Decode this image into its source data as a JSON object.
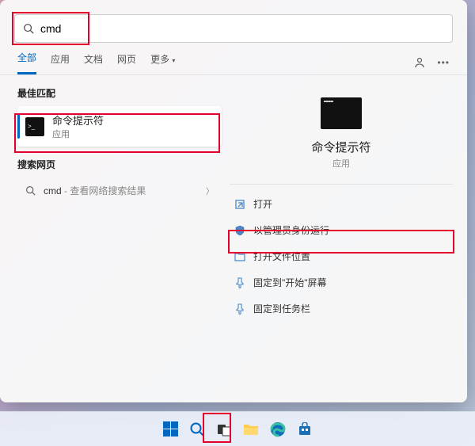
{
  "search": {
    "value": "cmd"
  },
  "tabs": {
    "items": [
      "全部",
      "应用",
      "文档",
      "网页",
      "更多"
    ],
    "active_index": 0
  },
  "left": {
    "best_match_label": "最佳匹配",
    "best_match": {
      "title": "命令提示符",
      "subtitle": "应用"
    },
    "web_label": "搜索网页",
    "web_item": {
      "query": "cmd",
      "suffix": " - 查看网络搜索结果"
    }
  },
  "detail": {
    "title": "命令提示符",
    "subtitle": "应用",
    "actions": [
      {
        "icon": "open",
        "label": "打开"
      },
      {
        "icon": "admin",
        "label": "以管理员身份运行"
      },
      {
        "icon": "folder",
        "label": "打开文件位置"
      },
      {
        "icon": "pin-start",
        "label": "固定到\"开始\"屏幕"
      },
      {
        "icon": "pin-taskbar",
        "label": "固定到任务栏"
      }
    ]
  }
}
